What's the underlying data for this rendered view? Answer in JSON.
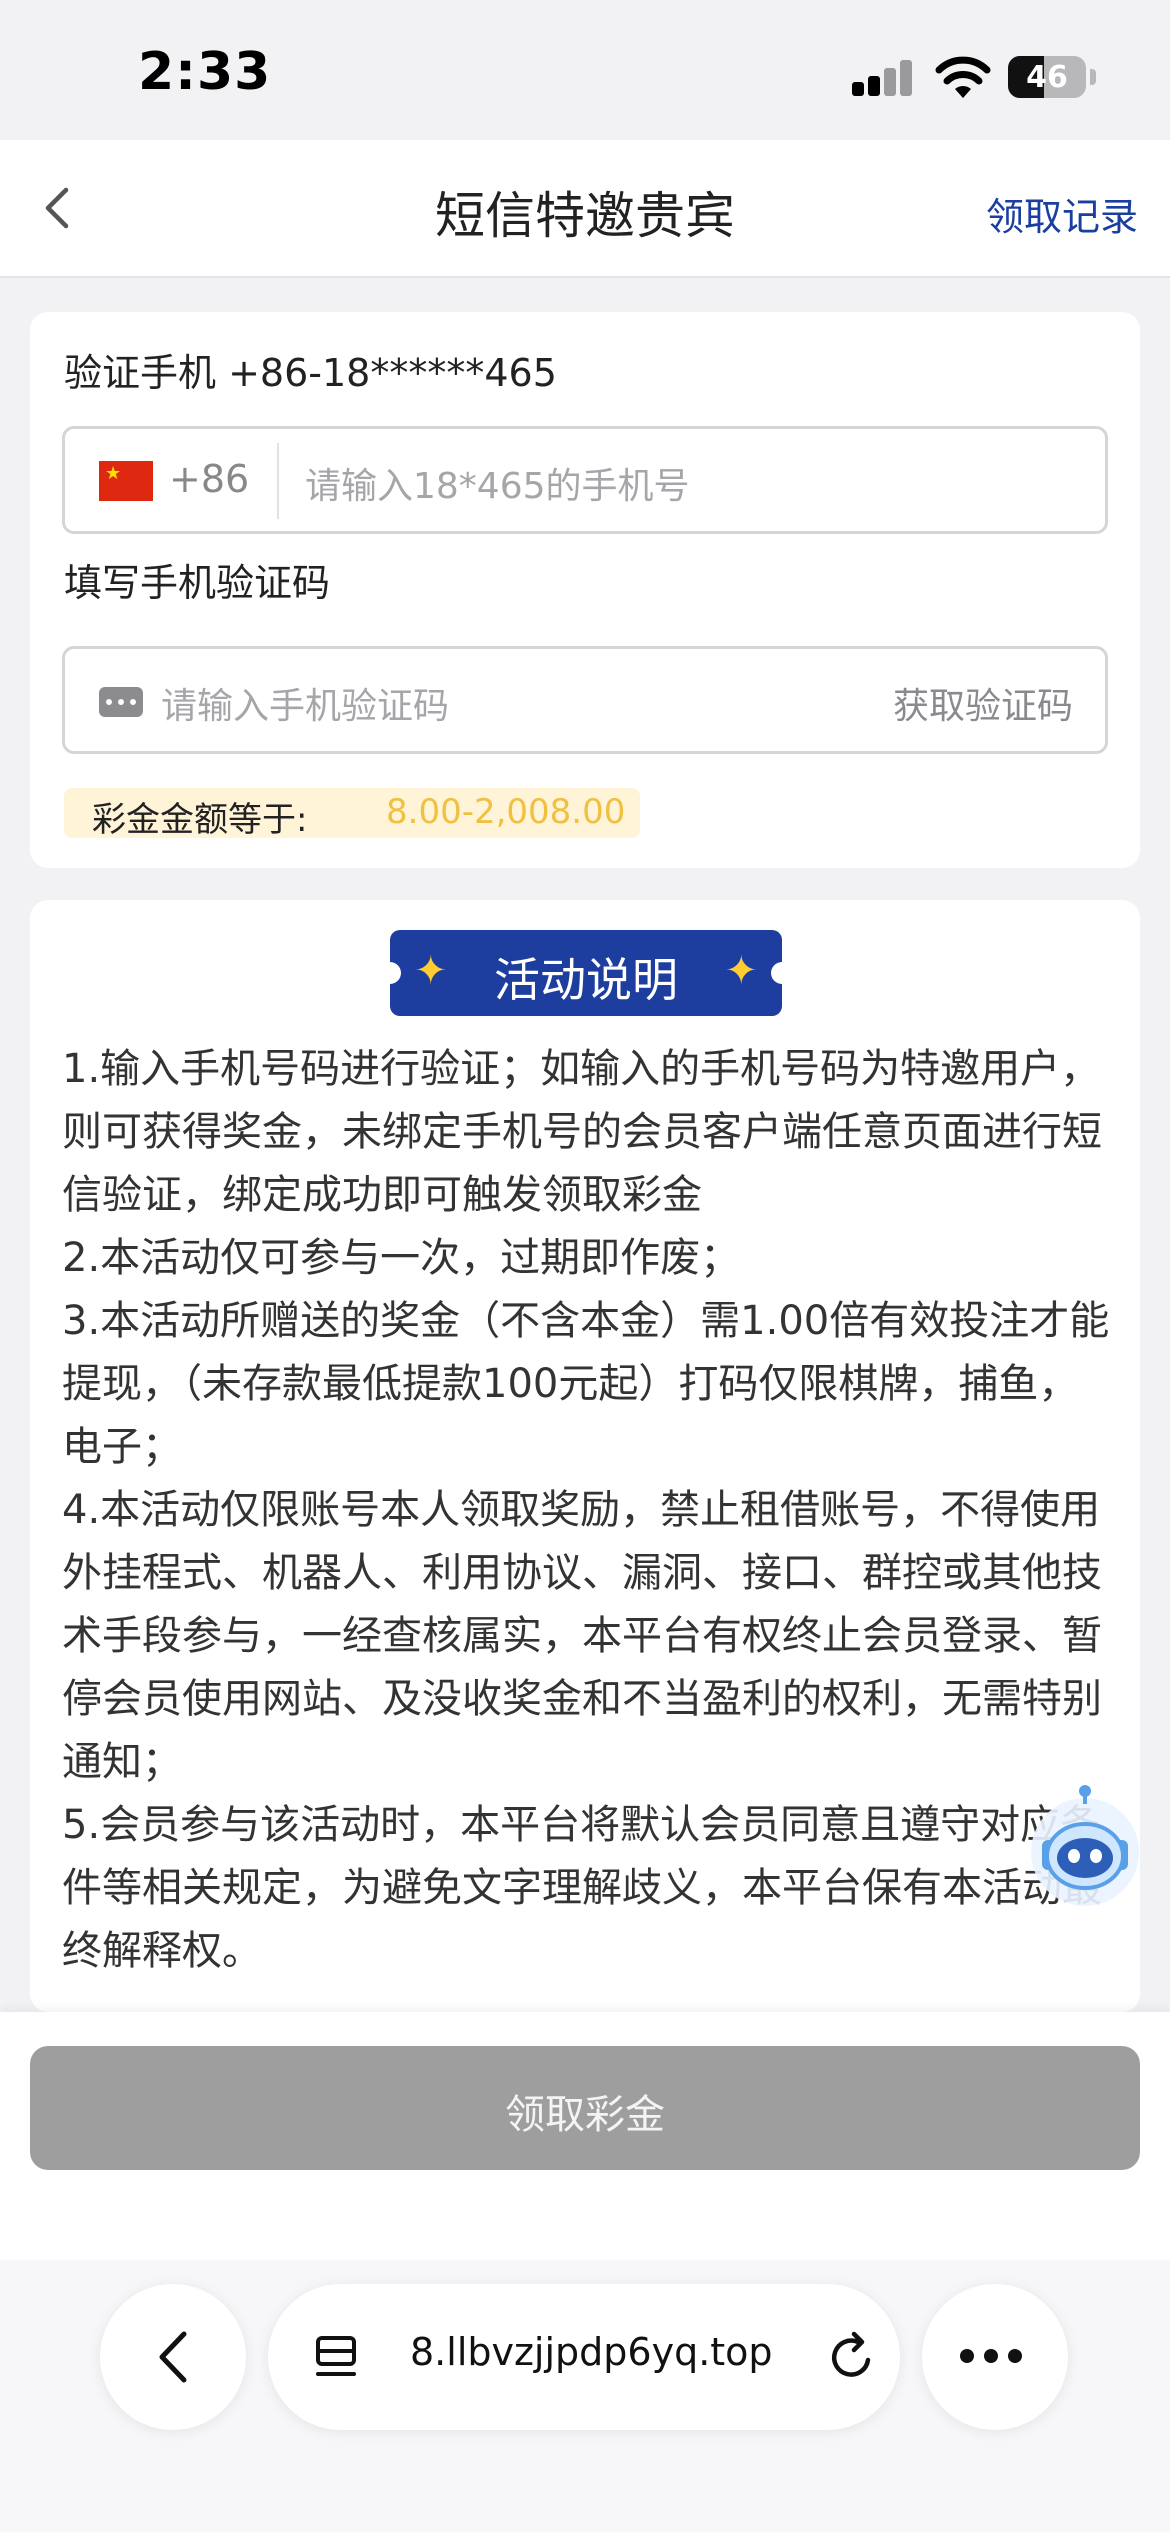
{
  "status_bar": {
    "time": "2:33",
    "battery_level": "46",
    "battery_fraction": 0.46,
    "icons": [
      "signal-icon",
      "wifi-icon",
      "battery-icon"
    ]
  },
  "nav": {
    "title": "短信特邀贵宾",
    "right_link": "领取记录",
    "back_icon": "chevron-left-icon"
  },
  "form": {
    "verify_label": "验证手机 +86-18******465",
    "country_code": "+86",
    "phone_placeholder": "请输入18*465的手机号",
    "code_label": "填写手机验证码",
    "code_placeholder": "请输入手机验证码",
    "get_code_label": "获取验证码",
    "bonus_label": "彩金金额等于:",
    "bonus_value": "8.00-2,008.00"
  },
  "activity": {
    "badge_title": "活动说明",
    "rules": [
      "1.输入手机号码进行验证；如输入的手机号码为特邀用户，则可获得奖金，未绑定手机号的会员客户端任意页面进行短信验证，绑定成功即可触发领取彩金",
      "2.本活动仅可参与一次，过期即作废；",
      "3.本活动所赠送的奖金（不含本金）需1.00倍有效投注才能提现，（未存款最低提款100元起）打码仅限棋牌，捕鱼，电子；",
      "4.本活动仅限账号本人领取奖励，禁止租借账号，不得使用外挂程式、机器人、利用协议、漏洞、接口、群控或其他技术手段参与，一经查核属实，本平台有权终止会员登录、暂停会员使用网站、及没收奖金和不当盈利的权利，无需特别通知；",
      "5.会员参与该活动时，本平台将默认会员同意且遵守对应条件等相关规定，为避免文字理解歧义，本平台保有本活动最终解释权。"
    ]
  },
  "claim_button": "领取彩金",
  "browser": {
    "url": "8.llbvzjjpdp6yq.top"
  },
  "colors": {
    "nav_link": "#1a3fa0",
    "badge_bg": "#1d3e9e",
    "bonus_value": "#f0c040",
    "bonus_bg": "#fff4d8",
    "button_disabled": "#9e9e9f"
  }
}
